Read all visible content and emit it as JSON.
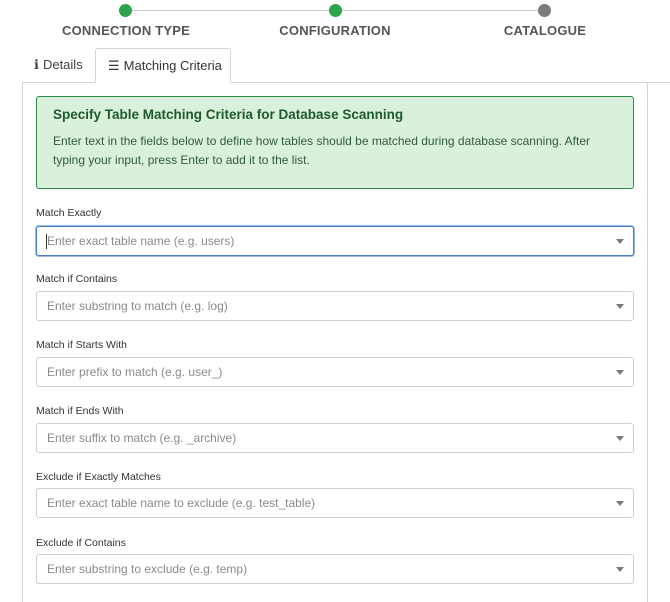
{
  "stepper": {
    "steps": [
      {
        "label": "CONNECTION TYPE",
        "status": "complete"
      },
      {
        "label": "CONFIGURATION",
        "status": "complete"
      },
      {
        "label": "CATALOGUE",
        "status": "pending"
      }
    ],
    "colors": {
      "complete": "#2fa44f",
      "pending": "#7b7b7b"
    }
  },
  "tabs": [
    {
      "label": "Details",
      "icon": "info-icon",
      "active": false
    },
    {
      "label": "Matching Criteria",
      "icon": "list-icon",
      "active": true
    }
  ],
  "info": {
    "title": "Specify Table Matching Criteria for Database Scanning",
    "text": "Enter text in the fields below to define how tables should be matched during database scanning. After typing your input, press Enter to add it to the list."
  },
  "fields": [
    {
      "label": "Match Exactly",
      "placeholder": "Enter exact table name (e.g. users)",
      "focused": true
    },
    {
      "label": "Match if Contains",
      "placeholder": "Enter substring to match (e.g. log)",
      "focused": false
    },
    {
      "label": "Match if Starts With",
      "placeholder": "Enter prefix to match (e.g. user_)",
      "focused": false
    },
    {
      "label": "Match if Ends With",
      "placeholder": "Enter suffix to match (e.g. _archive)",
      "focused": false
    },
    {
      "label": "Exclude if Exactly Matches",
      "placeholder": "Enter exact table name to exclude (e.g. test_table)",
      "focused": false
    },
    {
      "label": "Exclude if Contains",
      "placeholder": "Enter substring to exclude (e.g. temp)",
      "focused": false
    }
  ],
  "colors": {
    "accent_green": "#2fa44f",
    "info_bg": "#d9f0dd",
    "info_border": "#2f8a48",
    "focus_blue": "#4a7fc7"
  }
}
